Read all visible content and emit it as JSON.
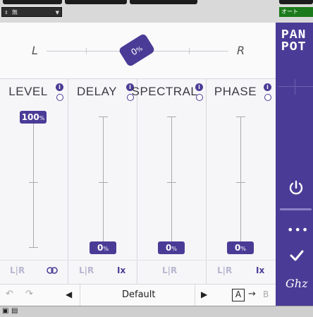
{
  "host": {
    "preset_select": "無",
    "automation": "オート"
  },
  "pan": {
    "left_label": "L",
    "right_label": "R",
    "value": "0",
    "unit": "%"
  },
  "columns": [
    {
      "title": "LEVEL",
      "value": "100",
      "unit": "%",
      "bottom_a": "L|R"
    },
    {
      "title": "DELAY",
      "value": "0",
      "unit": "%",
      "bottom_a": "L|R",
      "bottom_b": "Ix"
    },
    {
      "title": "SPECTRAL",
      "value": "0",
      "unit": "%",
      "bottom_a": "L|R"
    },
    {
      "title": "PHASE",
      "value": "0",
      "unit": "%",
      "bottom_a": "L|R",
      "bottom_b": "Ix"
    }
  ],
  "toolbar": {
    "preset_name": "Default",
    "ab_a": "A",
    "ab_arrow": "→",
    "ab_b": "B",
    "prev": "◀",
    "next": "▶",
    "undo": "↶",
    "redo": "↷"
  },
  "sidebar": {
    "logo_line1": "PAN",
    "logo_line2": "POT",
    "more": "•••",
    "brand": "Ghz"
  },
  "colors": {
    "accent": "#4a3c96",
    "muted": "#b8b6d0"
  }
}
